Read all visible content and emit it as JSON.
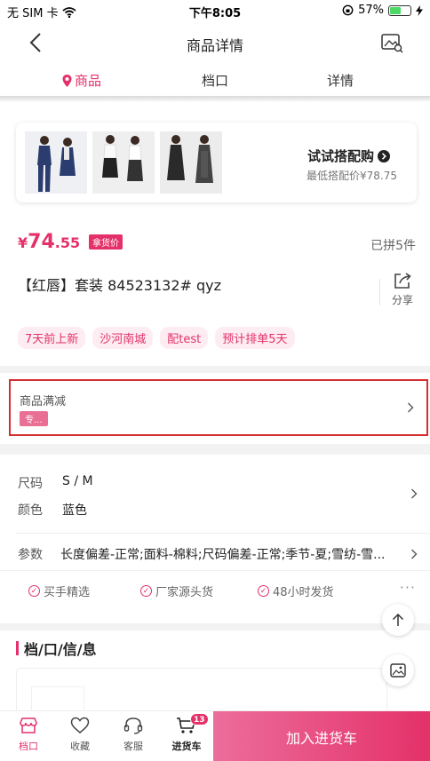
{
  "status_bar": {
    "carrier": "无 SIM 卡",
    "time": "下午8:05",
    "battery": "57%",
    "battery_level": 0.57
  },
  "nav": {
    "title": "商品详情"
  },
  "tabs": [
    {
      "label": "商品",
      "active": true
    },
    {
      "label": "档口",
      "active": false
    },
    {
      "label": "详情",
      "active": false
    }
  ],
  "combo": {
    "title": "试试搭配购",
    "subtitle": "最低搭配价¥78.75"
  },
  "product": {
    "currency": "¥",
    "price_int": "74",
    "price_dec": ".55",
    "price_badge": "拿货价",
    "sold": "已拼5件",
    "title": "【红唇】套装  84523132#  qyz",
    "share_label": "分享",
    "tags": [
      "7天前上新",
      "沙河南城",
      "配test",
      "预计排单5天"
    ]
  },
  "discount": {
    "label": "商品满减",
    "chip": "专..."
  },
  "specs": {
    "size_label": "尺码",
    "size_value": "S / M",
    "color_label": "颜色",
    "color_value": "蓝色",
    "param_label": "参数",
    "param_value": "长度偏差-正常;面料-棉料;尺码偏差-正常;季节-夏;雪纺-雪..."
  },
  "guarantees": [
    "买手精选",
    "厂家源头货",
    "48小时发货"
  ],
  "shop": {
    "heading": "档/口/信/息"
  },
  "bottom_bar": {
    "items": [
      {
        "label": "档口",
        "icon": "shop-icon"
      },
      {
        "label": "收藏",
        "icon": "heart-icon"
      },
      {
        "label": "客服",
        "icon": "headset-icon"
      },
      {
        "label": "进货车",
        "icon": "cart-icon",
        "badge": "13"
      }
    ],
    "add_to_cart": "加入进货车"
  },
  "colors": {
    "accent": "#e4316a",
    "highlight_border": "#d32f2f"
  }
}
